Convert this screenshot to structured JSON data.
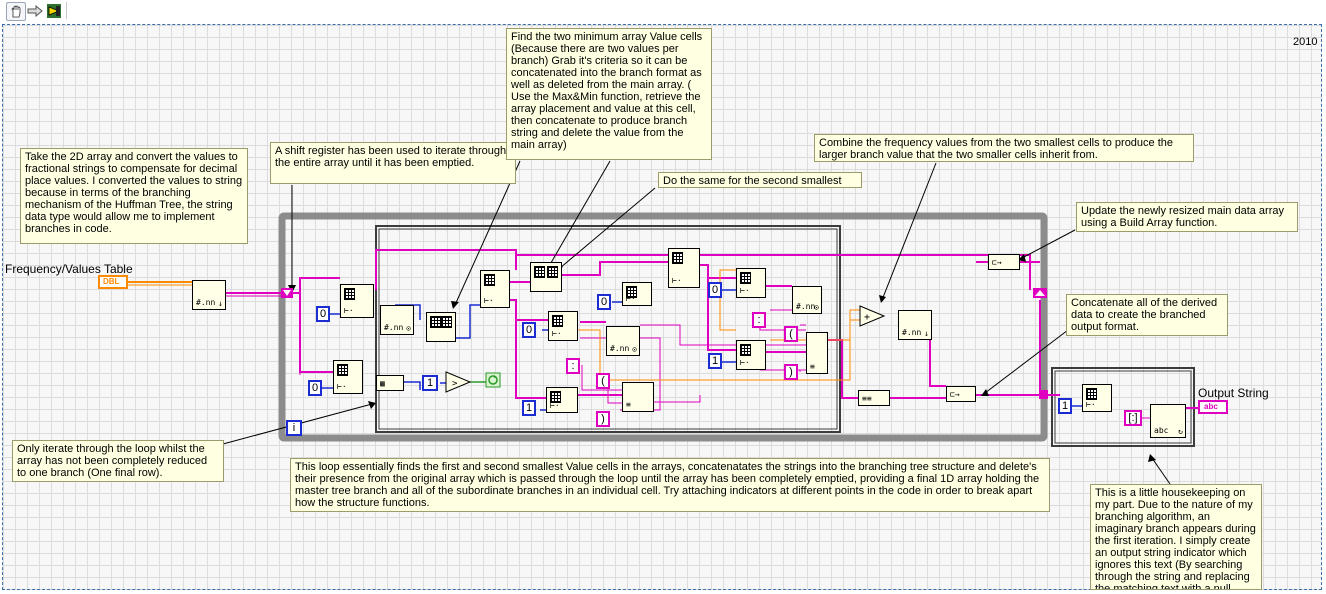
{
  "toolbar": {
    "buttons": [
      {
        "icon": "hand-tool-icon"
      },
      {
        "icon": "step-arrow-icon"
      },
      {
        "icon": "run-icon"
      }
    ]
  },
  "version_label": "2010",
  "controls": {
    "frequency_table_label": "Frequency/Values Table",
    "frequency_table_type": "DBL",
    "output_string_label": "Output String",
    "output_string_type": "abc"
  },
  "constants": {
    "zero": "0",
    "one": "1",
    "loop_count": "1",
    "i_terminal": "i"
  },
  "string_constants": {
    "colon": ":",
    "open_paren": "(",
    "close_paren": ")",
    "bracket_text": "[:]"
  },
  "notes": [
    {
      "id": "note-convert",
      "text": "Take the 2D array and convert the values to fractional strings to compensate for decimal place values. I converted the values to string because in terms of the branching mechanism of the Huffman Tree, the string data type would allow me to implement branches in code."
    },
    {
      "id": "note-shift-register",
      "text": "A shift register has been used to iterate through the entire array until it has been emptied."
    },
    {
      "id": "note-find-minimum",
      "text": "Find the two minimum array Value cells (Because there are two values per branch) Grab it's criteria so it can be concatenated into the branch format as well as deleted from the main array. ( Use the Max&Min function, retrieve the array placement and value at this cell, then concatenate to produce branch string and delete the value from the main array)"
    },
    {
      "id": "note-second-smallest",
      "text": "Do the same for the second smallest value."
    },
    {
      "id": "note-combine",
      "text": "Combine the frequency values from the two smallest cells to produce the larger branch value that the two smaller cells inherit from."
    },
    {
      "id": "note-update-array",
      "text": "Update the newly resized main data array using a Build Array function."
    },
    {
      "id": "note-concatenate",
      "text": "Concatenate all of the derived data to create the branched output format."
    },
    {
      "id": "note-iterate",
      "text": "Only iterate through the loop whilst the array has not been completely reduced to one branch (One final row)."
    },
    {
      "id": "note-loop-summary",
      "text": "This loop essentially finds the first and second smallest Value cells in the arrays, concatenatates the strings into the branching tree structure and delete's their presence from the original array which is passed through the loop until the array has been completely emptied, providing a final 1D array holding the master tree branch and all of the subordinate branches in an individual cell. Try attaching indicators at different points in the code in order to break apart how the structure functions."
    },
    {
      "id": "note-housekeeping",
      "text": "This is a little housekeeping on my part. Due to the nature of my branching algorithm, an imaginary branch appears during the first iteration. I simply create an output string indicator which ignores this text (By searching through the string and replacing the matching text with a null character)."
    }
  ],
  "colors": {
    "string_wire": "#e000c0",
    "numeric_wire": "#ff8a00",
    "integer_wire": "#1b2cd2",
    "loop_border": "#808080",
    "case_border": "#3c3c3c",
    "note_bg": "#ffffe1",
    "node_bg": "#ffffe8"
  }
}
